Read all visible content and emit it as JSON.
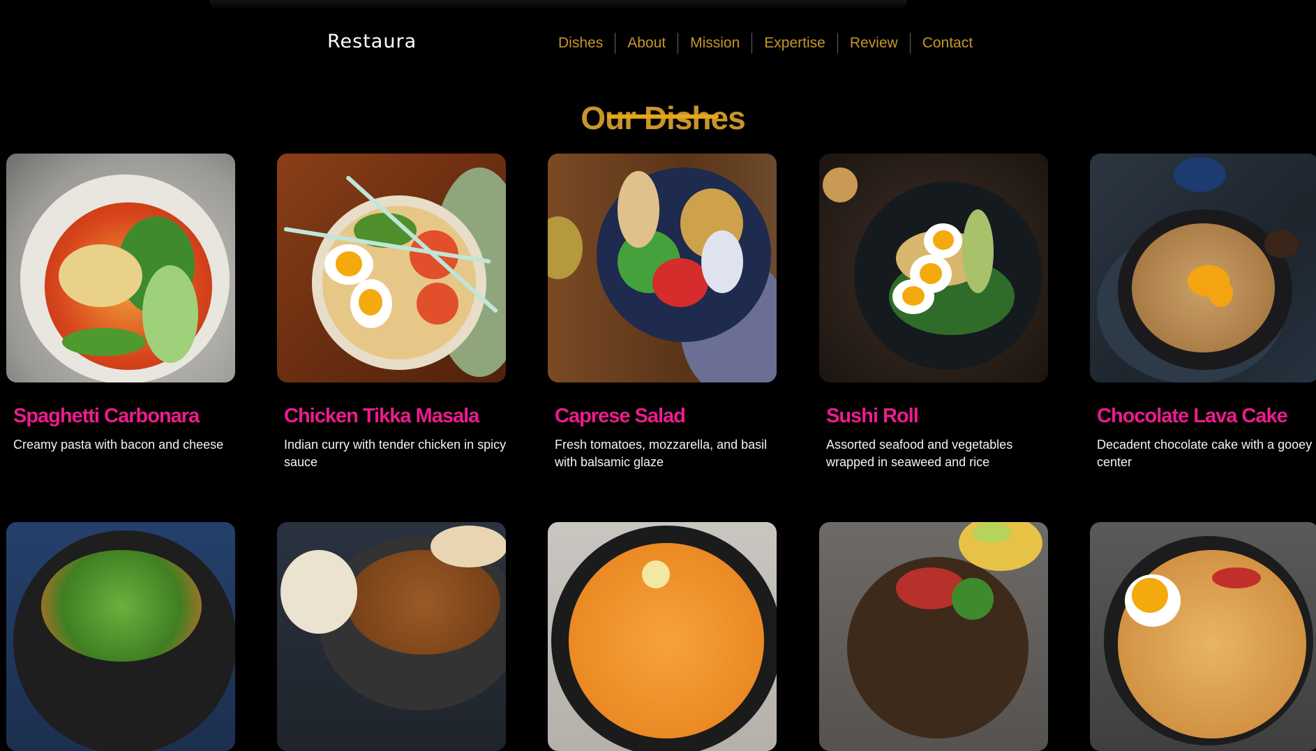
{
  "header": {
    "logo": "Restaura",
    "nav": [
      "Dishes",
      "About",
      "Mission",
      "Expertise",
      "Review",
      "Contact"
    ]
  },
  "section": {
    "title": "Our Dishes"
  },
  "dishes": [
    {
      "name": "Spaghetti Carbonara",
      "description": "Creamy pasta with bacon and cheese"
    },
    {
      "name": "Chicken Tikka Masala",
      "description": "Indian curry with tender chicken in spicy sauce"
    },
    {
      "name": "Caprese Salad",
      "description": "Fresh tomatoes, mozzarella, and basil with balsamic glaze"
    },
    {
      "name": "Sushi Roll",
      "description": "Assorted seafood and vegetables wrapped in seaweed and rice"
    },
    {
      "name": "Chocolate Lava Cake",
      "description": "Decadent chocolate cake with a gooey center"
    }
  ],
  "colors": {
    "accent": "#c8952b",
    "underline": "#e7a61a",
    "dish_name": "#ec1c8d",
    "background": "#000000"
  }
}
